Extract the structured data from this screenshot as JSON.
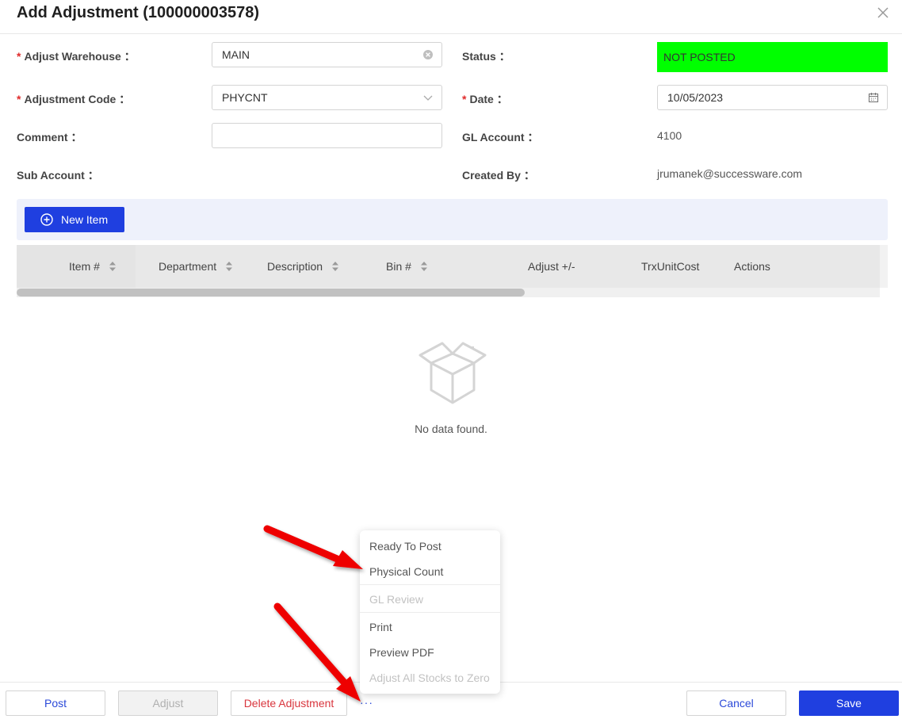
{
  "dialog": {
    "title": "Add Adjustment (100000003578)"
  },
  "form": {
    "adjust_warehouse": {
      "label": "Adjust Warehouse",
      "value": "MAIN"
    },
    "adjustment_code": {
      "label": "Adjustment Code",
      "value": "PHYCNT"
    },
    "comment": {
      "label": "Comment",
      "value": ""
    },
    "sub_account": {
      "label": "Sub Account",
      "value": ""
    },
    "status": {
      "label": "Status",
      "value": "NOT POSTED",
      "color": "#00ff00"
    },
    "date": {
      "label": "Date",
      "value": "10/05/2023"
    },
    "gl_account": {
      "label": "GL Account",
      "value": "4100"
    },
    "created_by": {
      "label": "Created By",
      "value": "jrumanek@successware.com"
    },
    "colon": "："
  },
  "toolbar": {
    "new_item_label": "New Item"
  },
  "table": {
    "columns": [
      "Item #",
      "Department",
      "Description",
      "Bin #",
      "Adjust +/-",
      "TrxUnitCost",
      "Actions"
    ],
    "empty_text": "No data found."
  },
  "footer": {
    "post_label": "Post",
    "adjust_label": "Adjust",
    "delete_label": "Delete Adjustment",
    "more_label": "···",
    "cancel_label": "Cancel",
    "save_label": "Save"
  },
  "menu": {
    "items": [
      "Ready To Post",
      "Physical Count",
      "GL Review",
      "Print",
      "Preview PDF",
      "Adjust All Stocks to Zero"
    ]
  },
  "colors": {
    "primary": "#1f3fe0",
    "danger": "#d9363e",
    "status_bg": "#00ff00",
    "arrow": "#ee0000"
  }
}
